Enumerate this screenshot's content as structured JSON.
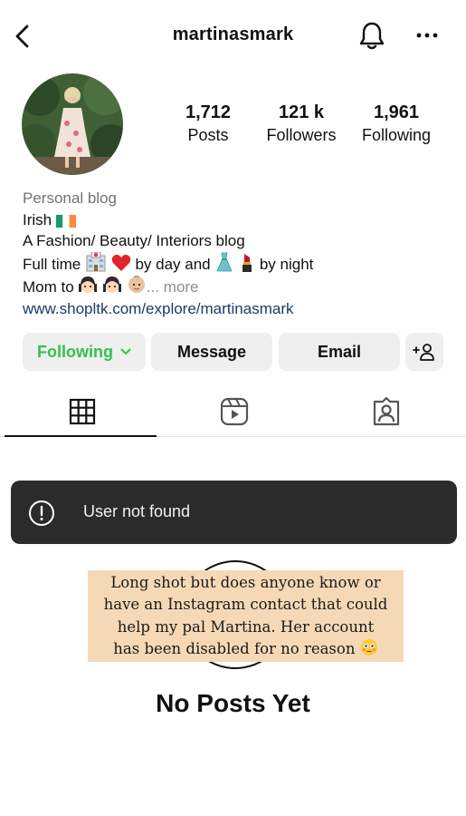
{
  "header": {
    "username": "martinasmark",
    "back_icon": "chevron-left-icon",
    "notification_icon": "bell-icon",
    "menu_icon": "more-horizontal-icon"
  },
  "stats": {
    "posts": {
      "count": "1,712",
      "label": "Posts"
    },
    "followers": {
      "count": "121 k",
      "label": "Followers"
    },
    "following": {
      "count": "1,961",
      "label": "Following"
    }
  },
  "bio": {
    "category": "Personal blog",
    "line1": "Irish",
    "line2": "A Fashion/ Beauty/ Interiors blog",
    "line3_a": "Full time",
    "line3_b": "by day and",
    "line3_c": "by night",
    "line4": "Mom to",
    "more": "... more",
    "link": "www.shopltk.com/explore/martinasmark"
  },
  "buttons": {
    "following": "Following",
    "message": "Message",
    "email": "Email",
    "add_user": "+person-icon"
  },
  "tabs": [
    "grid-icon",
    "reels-icon",
    "tagged-icon"
  ],
  "toast": {
    "icon": "alert-circle-icon",
    "message": "User not found"
  },
  "caption": {
    "line1": "Long shot but does anyone know or",
    "line2": "have an Instagram contact that could",
    "line3": "help my pal Martina. Her account",
    "line4": "has been disabled for no reason"
  },
  "empty_state": "No Posts Yet",
  "colors": {
    "following_green": "#35c04f",
    "button_bg": "#efefef",
    "toast_bg": "#2b2b2b",
    "caption_bg": "#f5d9b6",
    "link": "#1a3a6b"
  }
}
